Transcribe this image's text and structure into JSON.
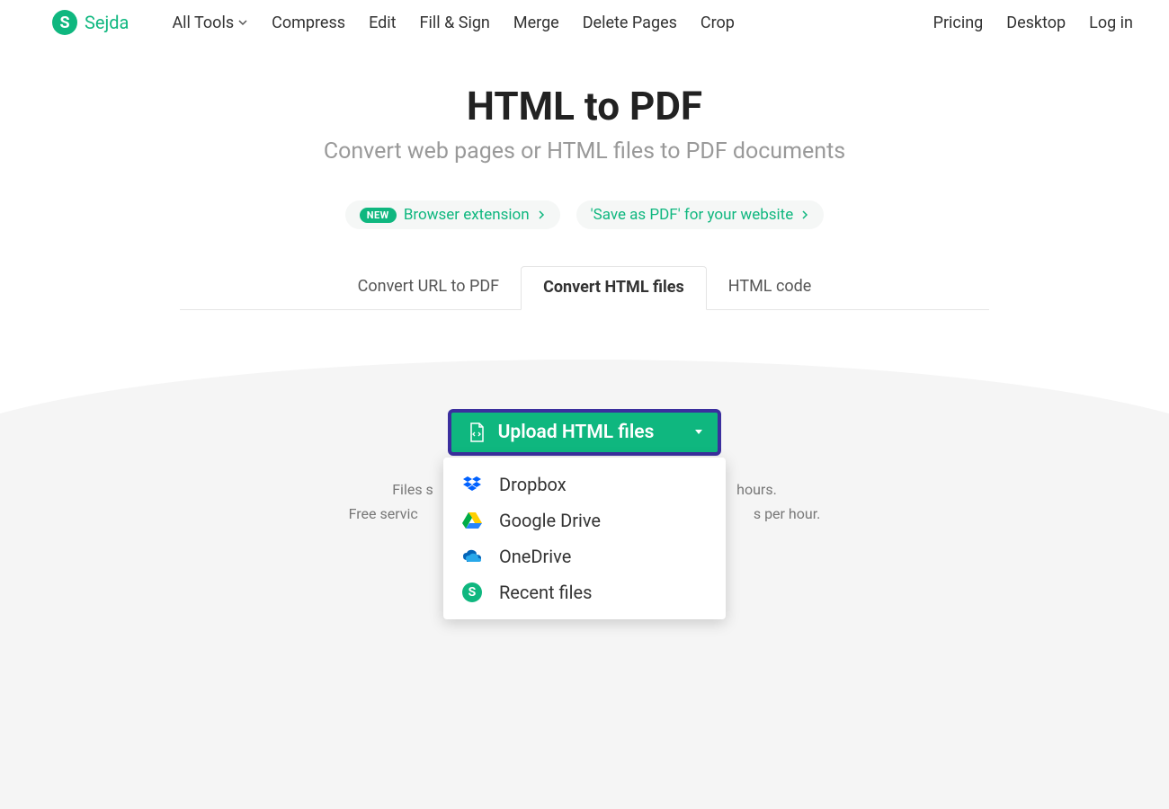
{
  "brand": {
    "name": "Sejda",
    "letter": "S"
  },
  "nav": {
    "items": [
      "All Tools",
      "Compress",
      "Edit",
      "Fill & Sign",
      "Merge",
      "Delete Pages",
      "Crop"
    ],
    "right": [
      "Pricing",
      "Desktop",
      "Log in"
    ]
  },
  "hero": {
    "title": "HTML to PDF",
    "subtitle": "Convert web pages or HTML files to PDF documents"
  },
  "pills": {
    "new_badge": "NEW",
    "browser_ext": "Browser extension",
    "save_as_pdf": "'Save as PDF' for your website"
  },
  "tabs": [
    "Convert URL to PDF",
    "Convert HTML files",
    "HTML code"
  ],
  "upload": {
    "label": "Upload HTML files",
    "options": [
      "Dropbox",
      "Google Drive",
      "OneDrive",
      "Recent files"
    ]
  },
  "footnotes": {
    "line1_left": "Files s",
    "line1_right": " hours.",
    "line2_left": "Free servic",
    "line2_right": "s per hour."
  }
}
